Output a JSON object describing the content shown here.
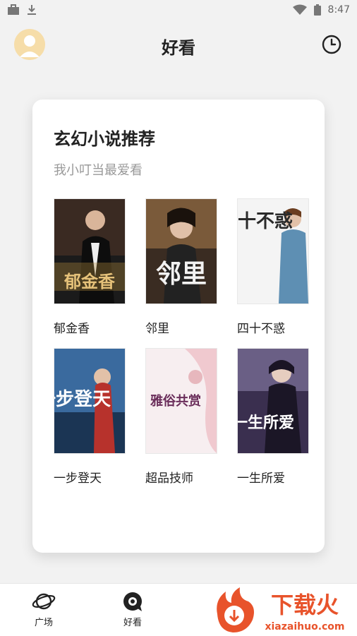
{
  "status_bar": {
    "time": "8:47"
  },
  "header": {
    "title": "好看"
  },
  "card": {
    "title": "玄幻小说推荐",
    "subtitle": "我小叮当最爱看",
    "books": [
      {
        "title": "郁金香",
        "cover_text": "郁金香"
      },
      {
        "title": "邻里",
        "cover_text": "邻里"
      },
      {
        "title": "四十不惑",
        "cover_text": "四十不惑"
      },
      {
        "title": "一步登天",
        "cover_text": "一步登天"
      },
      {
        "title": "超品技师",
        "cover_text": "雅俗共赏"
      },
      {
        "title": "一生所爱",
        "cover_text": "一生所爱"
      }
    ]
  },
  "bottom_nav": {
    "items": [
      {
        "label": "广场",
        "icon": "planet-icon"
      },
      {
        "label": "好看",
        "icon": "eye-chat-icon"
      }
    ]
  },
  "watermark": {
    "brand": "下载火",
    "url": "xiazaihuo.com"
  }
}
